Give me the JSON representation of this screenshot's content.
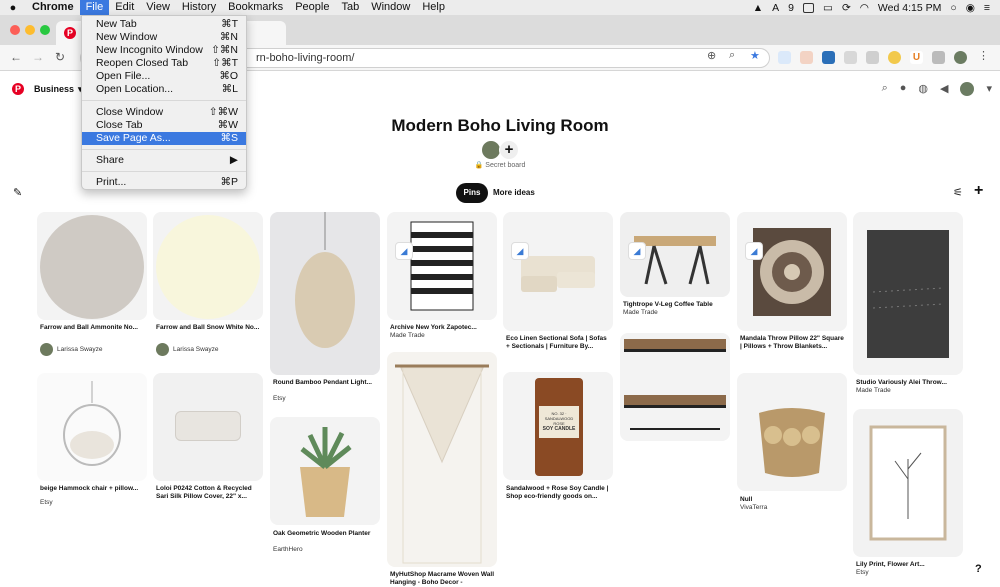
{
  "menubar": {
    "app": "Chrome",
    "items": [
      "File",
      "Edit",
      "View",
      "History",
      "Bookmarks",
      "People",
      "Tab",
      "Window",
      "Help"
    ],
    "status_number": "9",
    "clock": "Wed 4:15 PM"
  },
  "tab": {
    "label": "P"
  },
  "omnibox": {
    "url": "rn-boho-living-room/"
  },
  "file_menu": {
    "items": [
      {
        "label": "New Tab",
        "shortcut": "⌘T"
      },
      {
        "label": "New Window",
        "shortcut": "⌘N"
      },
      {
        "label": "New Incognito Window",
        "shortcut": "⇧⌘N"
      },
      {
        "label": "Reopen Closed Tab",
        "shortcut": "⇧⌘T"
      },
      {
        "label": "Open File...",
        "shortcut": "⌘O"
      },
      {
        "label": "Open Location...",
        "shortcut": "⌘L"
      },
      {
        "label": "Close Window",
        "shortcut": "⇧⌘W"
      },
      {
        "label": "Close Tab",
        "shortcut": "⌘W"
      },
      {
        "label": "Save Page As...",
        "shortcut": "⌘S"
      },
      {
        "label": "Share",
        "shortcut": "▶"
      },
      {
        "label": "Print...",
        "shortcut": "⌘P"
      }
    ]
  },
  "pinterest": {
    "business_label": "Business",
    "board_title": "Modern Boho Living Room",
    "secret_label": "Secret board",
    "tabs": [
      "Pins",
      "More ideas"
    ],
    "help": "?"
  },
  "pins": [
    {
      "title": "Farrow and Ball Ammonite No...",
      "user": "Larissa Swayze"
    },
    {
      "title": "Farrow and Ball Snow White No...",
      "user": "Larissa Swayze"
    },
    {
      "title": "Round Bamboo Pendant Light...",
      "source": "Etsy"
    },
    {
      "title": "Archive New York Zapotec...",
      "source": "Made Trade"
    },
    {
      "title": "Eco Linen Sectional Sofa | Sofas + Sectionals | Furniture By...",
      "source": ""
    },
    {
      "title": "Tightrope V-Leg Coffee Table",
      "source": "Made Trade"
    },
    {
      "title": "Mandala Throw Pillow 22\" Square | Pillows + Throw Blankets...",
      "source": ""
    },
    {
      "title": "Studio Variously Alei Throw...",
      "source": "Made Trade"
    },
    {
      "title": "beige Hammock chair + pillow...",
      "source": "Etsy"
    },
    {
      "title": "Loloi P0242 Cotton & Recycled Sari Silk Pillow Cover, 22\" x...",
      "source": ""
    },
    {
      "title": "Oak Geometric Wooden Planter",
      "source": "EarthHero"
    },
    {
      "title": "MyHutShop Macrame Woven Wall Hanging - Boho Decor -",
      "source": ""
    },
    {
      "title": "Sandalwood + Rose Soy Candle | Shop eco-friendly goods on...",
      "source": ""
    },
    {
      "title": "Null",
      "source": "VivaTerra"
    },
    {
      "title": "Lily Print, Flower Art...",
      "source": "Etsy"
    }
  ],
  "candle_label": {
    "line1": "NO. 32 · SANDALWOOD ROSE",
    "line2": "SOY CANDLE"
  },
  "colors": {
    "accent": "#3b79e0",
    "pinterest_red": "#e60023",
    "ammonite": "#cfcac4",
    "snow_white": "#f8f6dc"
  }
}
